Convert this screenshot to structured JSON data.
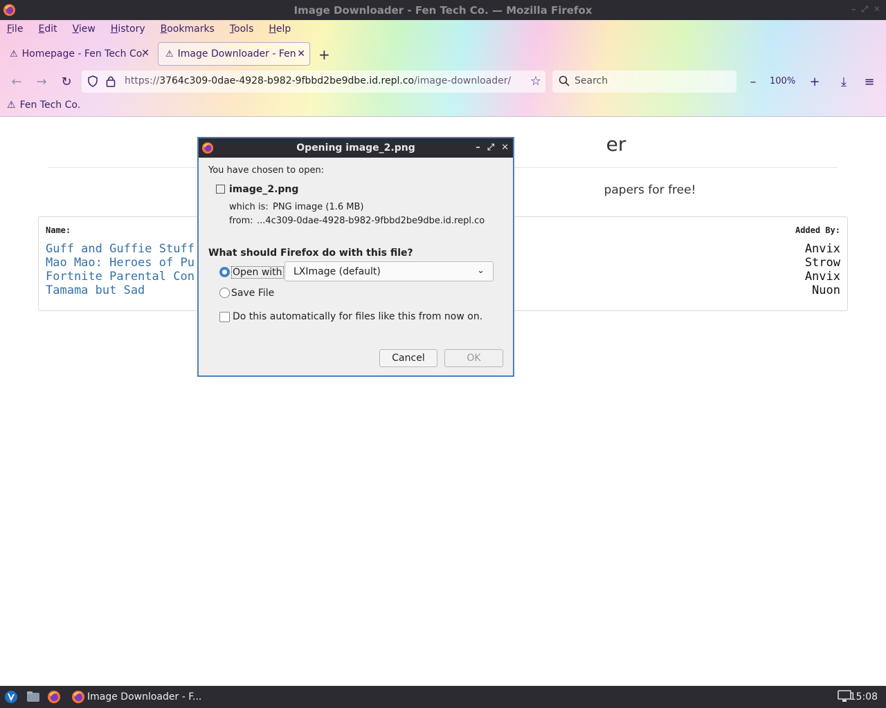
{
  "window": {
    "title": "Image Downloader - Fen Tech Co. — Mozilla Firefox"
  },
  "menu": [
    "File",
    "Edit",
    "View",
    "History",
    "Bookmarks",
    "Tools",
    "Help"
  ],
  "tabs": [
    {
      "label": "Homepage - Fen Tech Co.",
      "active": false
    },
    {
      "label": "Image Downloader - Fen",
      "active": true
    }
  ],
  "nav": {
    "url_prefix": "https://",
    "url_domain": "3764c309-0dae-4928-b982-9fbbd2be9dbe.id.repl.co",
    "url_path": "/image-downloader/",
    "search_placeholder": "Search",
    "zoom": "100%"
  },
  "bookmarks": [
    {
      "label": "Fen Tech Co."
    }
  ],
  "page": {
    "title_visible": "er",
    "subtitle_visible": "papers for free!",
    "table": {
      "header_name": "Name:",
      "header_added_by": "Added By:",
      "rows": [
        {
          "name": "Guff and Guffie Stuff",
          "added_by": "Anvix"
        },
        {
          "name": "Mao Mao: Heroes of Pu",
          "added_by": "Strow"
        },
        {
          "name": "Fortnite Parental Con",
          "added_by": "Anvix"
        },
        {
          "name": "Tamama but Sad",
          "added_by": "Nuon"
        }
      ]
    }
  },
  "dialog": {
    "title": "Opening image_2.png",
    "intro": "You have chosen to open:",
    "filename": "image_2.png",
    "which_is_label": "which is:",
    "which_is_value": "PNG image (1.6 MB)",
    "from_label": "from:",
    "from_value": "...4c309-0dae-4928-b982-9fbbd2be9dbe.id.repl.co",
    "question": "What should Firefox do with this file?",
    "open_with_label": "Open with",
    "open_with_selected": "LXImage (default)",
    "save_file_label": "Save File",
    "auto_label": "Do this automatically for files like this from now on.",
    "cancel_label": "Cancel",
    "ok_label": "OK",
    "open_with_checked": true,
    "save_file_checked": false,
    "auto_checked": false
  },
  "taskbar": {
    "window_label": "Image Downloader - F...",
    "clock": "15:08"
  },
  "colors": {
    "accent": "#3f82d0",
    "link": "#3571a8",
    "chrome_text": "#3a1f6a",
    "titlebar": "#2b2b31"
  }
}
